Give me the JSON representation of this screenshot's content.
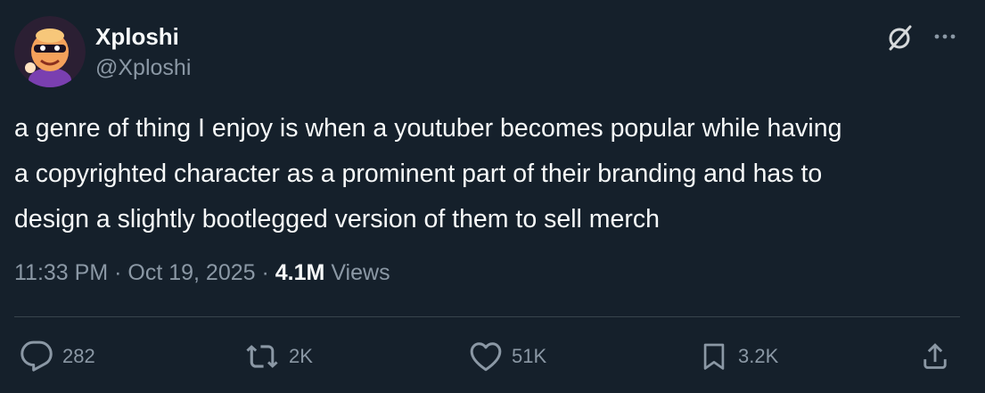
{
  "post": {
    "author": {
      "display_name": "Xploshi",
      "handle": "@Xploshi"
    },
    "text": "a genre of thing I enjoy is when a youtuber becomes popular while having\na copyrighted character as a prominent part of their branding and has to\ndesign a slightly bootlegged version of them to sell merch",
    "time": "11:33 PM",
    "separator": "·",
    "date": "Oct 19, 2025",
    "views_count": "4.1M",
    "views_label": "Views"
  },
  "actions": {
    "replies": "282",
    "reposts": "2K",
    "likes": "51K",
    "bookmarks": "3.2K"
  },
  "icons": {
    "grok": "grok-icon",
    "more": "more-horizontal-icon",
    "reply": "reply-bubble-icon",
    "repost": "repost-icon",
    "like": "heart-icon",
    "bookmark": "bookmark-icon",
    "share": "share-icon"
  },
  "colors": {
    "background": "#15202b",
    "text_primary": "#f7f9f9",
    "text_secondary": "#8b98a5",
    "divider": "#38444d"
  }
}
